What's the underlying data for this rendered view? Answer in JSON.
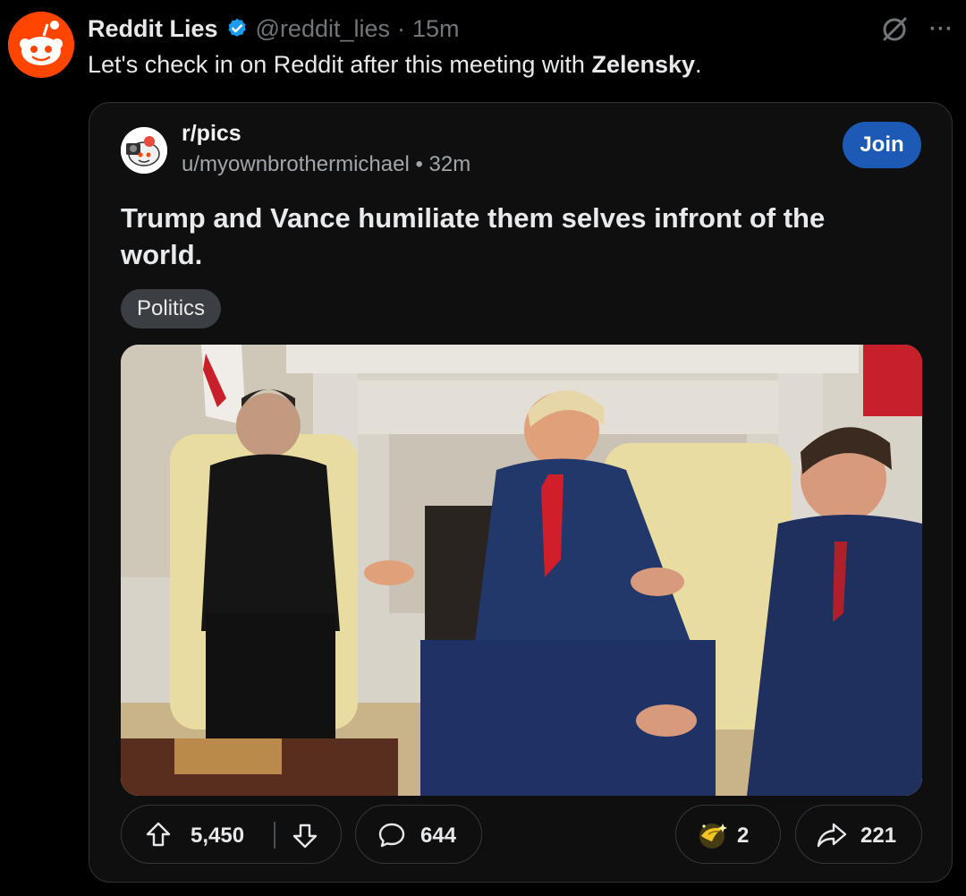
{
  "tweet": {
    "display_name": "Reddit Lies",
    "handle": "@reddit_lies",
    "separator": "·",
    "time": "15m",
    "text_before": "Let's check in on Reddit after this meeting with ",
    "text_bold": "Zelensky",
    "text_after": ".",
    "more_label": "···"
  },
  "quote": {
    "subreddit": "r/pics",
    "username": "u/myownbrothermichael",
    "separator": "•",
    "time": "32m",
    "join_label": "Join",
    "title": "Trump and Vance humiliate them selves infront of the world.",
    "flair": "Politics",
    "upvotes": "5,450",
    "comments": "644",
    "awards": "2",
    "shares": "221"
  },
  "colors": {
    "background": "#000000",
    "avatar_brand": "#ff4500",
    "verified": "#1d9bf0",
    "join_button": "#1c5ab5",
    "card_background": "#0f0f10"
  },
  "icons": {
    "avatar": "reddit-snoo-icon",
    "verified": "verified-badge-icon",
    "grok": "grok-icon",
    "more": "more-icon",
    "upvote": "arrow-up-icon",
    "downvote": "arrow-down-icon",
    "comment": "comment-bubble-icon",
    "award": "award-icon",
    "share": "share-arrow-icon"
  }
}
